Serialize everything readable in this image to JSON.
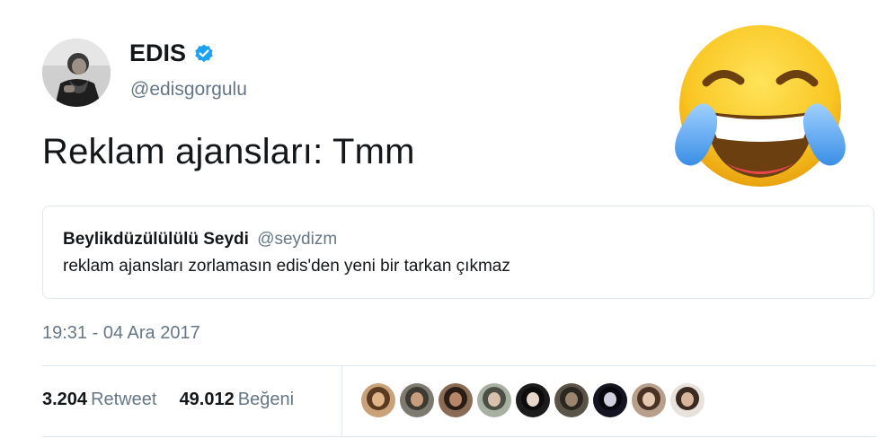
{
  "author": {
    "display_name": "EDIS",
    "handle": "@edisgorgulu",
    "verified_icon": "verified-badge-icon"
  },
  "tweet": {
    "text": "Reklam ajansları: Tmm",
    "timestamp": "19:31 - 04 Ara 2017"
  },
  "quoted_tweet": {
    "display_name": "Beylikdüzülülülü Seydi",
    "handle": "@seydizm",
    "text": "reklam ajansları zorlamasın edis'den yeni bir tarkan çıkmaz"
  },
  "stats": {
    "retweets_count": "3.204",
    "retweets_label": "Retweet",
    "likes_count": "49.012",
    "likes_label": "Beğeni"
  },
  "emoji": "face-with-tears-of-joy-icon",
  "colors": {
    "text_primary": "#14171a",
    "text_secondary": "#657786",
    "verified_blue": "#1da1f2",
    "border": "#e1e8ed"
  }
}
